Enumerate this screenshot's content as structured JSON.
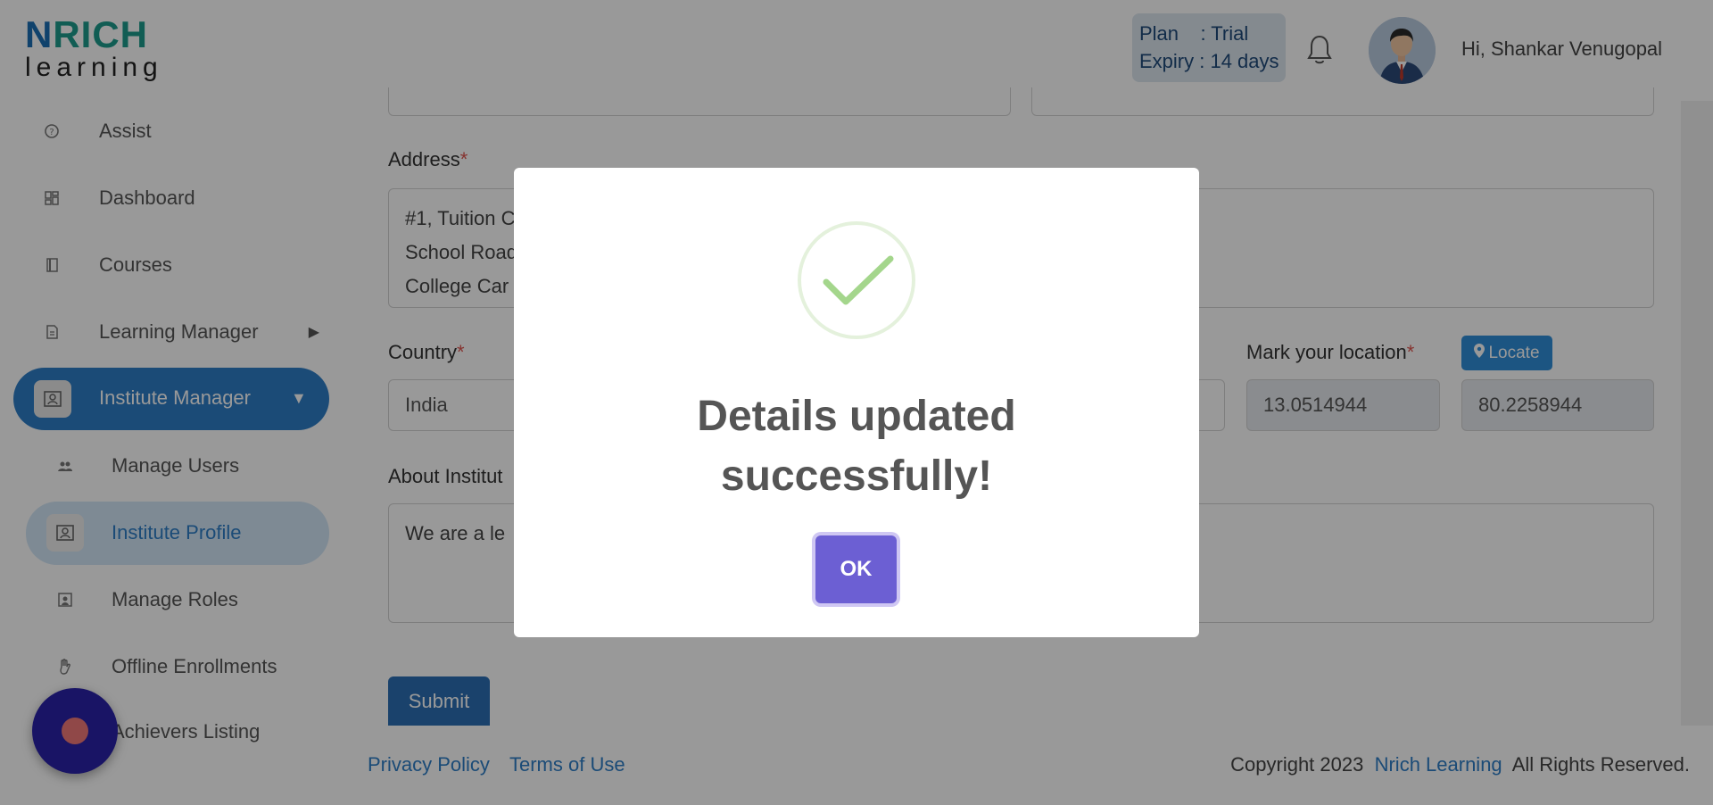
{
  "brand": {
    "logo_top_1": "N",
    "logo_top_2": "RICH",
    "logo_bottom": "learning"
  },
  "header": {
    "plan_line": "Plan    : Trial",
    "expiry_line": "Expiry : 14 days",
    "greeting": "Hi, Shankar Venugopal",
    "icons": {
      "bell": "bell-icon",
      "avatar": "user-avatar"
    }
  },
  "sidebar": {
    "items": [
      {
        "label": "Assist",
        "icon": "assist-icon"
      },
      {
        "label": "Dashboard",
        "icon": "dashboard-icon"
      },
      {
        "label": "Courses",
        "icon": "book-icon"
      },
      {
        "label": "Learning Manager",
        "icon": "document-icon"
      },
      {
        "label": "Institute Manager",
        "icon": "institute-icon"
      },
      {
        "label": "Manage Users",
        "icon": "users-icon"
      },
      {
        "label": "Institute Profile",
        "icon": "profile-icon"
      },
      {
        "label": "Manage Roles",
        "icon": "roles-icon"
      },
      {
        "label": "Offline Enrollments",
        "icon": "hand-icon"
      },
      {
        "label": "Achievers Listing",
        "icon": "trophy-icon"
      }
    ],
    "active_parent_color": "#2e7ec7",
    "active_child_color": "#d2e6f7"
  },
  "form": {
    "address_label": "Address",
    "address_lines": [
      "#1, Tuition C",
      "School Road",
      "College Car"
    ],
    "country_label": "Country",
    "country_value": "India",
    "location_label": "Mark your location",
    "locate_label": "Locate",
    "latitude": "13.0514944",
    "longitude": "80.2258944",
    "about_label": "About Institut",
    "about_value": "We are a le",
    "submit_label": "Submit",
    "required_mark": "*"
  },
  "footer": {
    "privacy": "Privacy Policy",
    "terms": "Terms of Use",
    "copyright_prefix": "Copyright 2023",
    "company": "Nrich Learning",
    "copyright_suffix": "All Rights Reserved."
  },
  "modal": {
    "title_line1": "Details updated",
    "title_line2": "successfully!",
    "ok_label": "OK",
    "icon": "check-icon",
    "ok_color": "#6c5fd3"
  }
}
